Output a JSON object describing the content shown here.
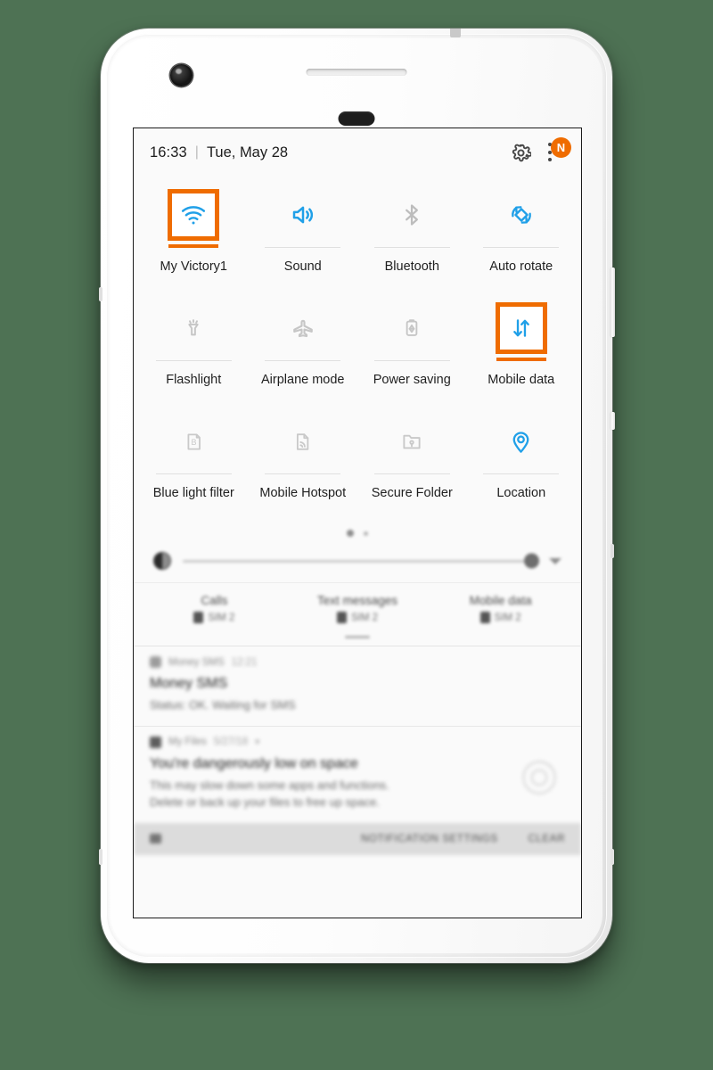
{
  "status_bar": {
    "time": "16:33",
    "separator": "|",
    "date": "Tue, May 28",
    "gear_icon": "gear-icon",
    "menu_icon": "more-vertical-icon",
    "badge": "N"
  },
  "quick_settings": {
    "rows": [
      [
        {
          "label": "My Victory1",
          "icon": "wifi-icon",
          "state": "on",
          "selected": true
        },
        {
          "label": "Sound",
          "icon": "sound-icon",
          "state": "on",
          "selected": false
        },
        {
          "label": "Bluetooth",
          "icon": "bluetooth-icon",
          "state": "off",
          "selected": false
        },
        {
          "label": "Auto rotate",
          "icon": "auto-rotate-icon",
          "state": "on",
          "selected": false
        }
      ],
      [
        {
          "label": "Flashlight",
          "icon": "flashlight-icon",
          "state": "off",
          "selected": false
        },
        {
          "label": "Airplane mode",
          "icon": "airplane-icon",
          "state": "off",
          "selected": false
        },
        {
          "label": "Power saving",
          "icon": "power-saving-icon",
          "state": "off",
          "selected": false
        },
        {
          "label": "Mobile data",
          "icon": "mobile-data-icon",
          "state": "on",
          "selected": true
        }
      ],
      [
        {
          "label": "Blue light filter",
          "icon": "blue-light-filter-icon",
          "state": "off",
          "selected": false
        },
        {
          "label": "Mobile Hotspot",
          "icon": "hotspot-icon",
          "state": "off",
          "selected": false
        },
        {
          "label": "Secure Folder",
          "icon": "secure-folder-icon",
          "state": "off",
          "selected": false
        },
        {
          "label": "Location",
          "icon": "location-pin-icon",
          "state": "on",
          "selected": false
        }
      ]
    ],
    "page_indicator": {
      "pages": 2,
      "current": 1
    }
  },
  "brightness": {
    "icon": "brightness-icon",
    "value_percent": 93,
    "expand_icon": "chevron-down-icon"
  },
  "sim_status": [
    {
      "title": "Calls",
      "value": "SIM 2"
    },
    {
      "title": "Text messages",
      "value": "SIM 2"
    },
    {
      "title": "Mobile data",
      "value": "SIM 2"
    }
  ],
  "notifications": [
    {
      "app": "Money SMS",
      "time": "12:21",
      "title": "Money SMS",
      "body": "Status: OK. Waiting for SMS"
    },
    {
      "app": "My Files",
      "time": "5/27/18",
      "title": "You're dangerously low on space",
      "body": "This may slow down some apps and functions.\nDelete or back up your files to free up space."
    }
  ],
  "notification_footer": {
    "settings_label": "NOTIFICATION SETTINGS",
    "clear_label": "CLEAR"
  },
  "colors": {
    "accent_blue": "#20A0E8",
    "highlight_orange": "#EF6C00",
    "disabled_grey": "#BDBDBD",
    "background_green": "#4E7254"
  }
}
